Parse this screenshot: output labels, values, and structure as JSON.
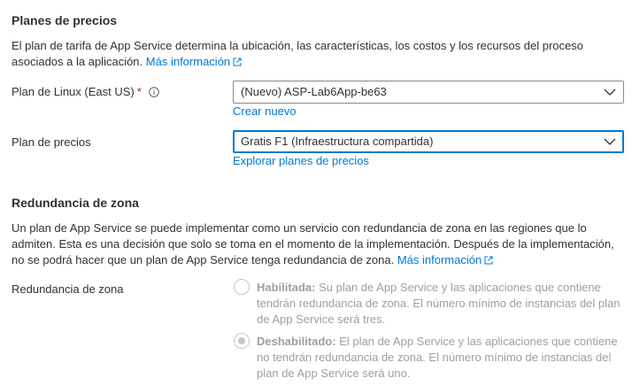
{
  "plans_section": {
    "title": "Planes de precios",
    "description": "El plan de tarifa de App Service determina la ubicación, las características, los costos y los recursos del proceso asociados a la aplicación.",
    "more_info": "Más información"
  },
  "linux_plan": {
    "label": "Plan de Linux (East US)",
    "required_mark": "*",
    "value": "(Nuevo) ASP-Lab6App-be63",
    "create_link": "Crear nuevo"
  },
  "pricing_plan": {
    "label": "Plan de precios",
    "value": "Gratis F1 (Infraestructura compartida)",
    "explore_link": "Explorar planes de precios"
  },
  "zone_section": {
    "title": "Redundancia de zona",
    "description": "Un plan de App Service se puede implementar como un servicio con redundancia de zona en las regiones que lo admiten. Esta es una decisión que solo se toma en el momento de la implementación. Después de la implementación, no se podrá hacer que un plan de App Service tenga redundancia de zona.",
    "more_info": "Más información",
    "field_label": "Redundancia de zona",
    "options": [
      {
        "title": "Habilitada:",
        "text": "Su plan de App Service y las aplicaciones que contiene tendrán redundancia de zona. El número mínimo de instancias del plan de App Service será tres.",
        "selected": false
      },
      {
        "title": "Deshabilitado:",
        "text": "El plan de App Service y las aplicaciones que contiene no tendrán redundancia de zona. El número mínimo de instancias del plan de App Service será uno.",
        "selected": true
      }
    ]
  },
  "colors": {
    "link": "#0078d4",
    "required": "#a4262c",
    "focus_border": "#0078d4",
    "disabled_text": "#a19f9d"
  }
}
